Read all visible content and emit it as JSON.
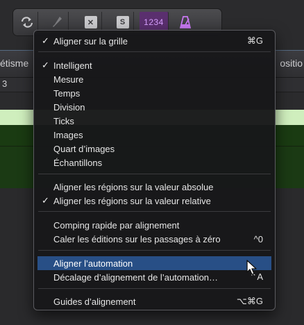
{
  "toolbar": {
    "counter_text": "1234",
    "solo_text": "S",
    "buttons": [
      {
        "name": "cycle-icon"
      },
      {
        "name": "tuner-icon"
      },
      {
        "name": "mute-icon"
      },
      {
        "name": "solo-icon"
      },
      {
        "name": "lcd-counter"
      },
      {
        "name": "metronome-icon"
      }
    ]
  },
  "background": {
    "left_text": "étisme",
    "right_text": "ositio",
    "bar_number": "3"
  },
  "menu": {
    "items": [
      {
        "label": "Aligner sur la grille",
        "shortcut": "⌘G",
        "checked": true
      },
      {
        "label": "Intelligent",
        "shortcut": "",
        "checked": true
      },
      {
        "label": "Mesure",
        "shortcut": "",
        "checked": false
      },
      {
        "label": "Temps",
        "shortcut": "",
        "checked": false
      },
      {
        "label": "Division",
        "shortcut": "",
        "checked": false
      },
      {
        "label": "Ticks",
        "shortcut": "",
        "checked": false
      },
      {
        "label": "Images",
        "shortcut": "",
        "checked": false
      },
      {
        "label": "Quart d’images",
        "shortcut": "",
        "checked": false
      },
      {
        "label": "Échantillons",
        "shortcut": "",
        "checked": false
      },
      {
        "label": "Aligner les régions sur la valeur absolue",
        "shortcut": "",
        "checked": false
      },
      {
        "label": "Aligner les régions sur la valeur relative",
        "shortcut": "",
        "checked": true
      },
      {
        "label": "Comping rapide par alignement",
        "shortcut": "",
        "checked": false
      },
      {
        "label": "Caler les éditions sur les passages à zéro",
        "shortcut": "^0",
        "checked": false
      },
      {
        "label": "Aligner l’automation",
        "shortcut": "",
        "checked": false,
        "highlighted": true
      },
      {
        "label": "Décalage d’alignement de l’automation…",
        "shortcut": "⌃A",
        "checked": false
      },
      {
        "label": "Guides d’alignement",
        "shortcut": "⌥⌘G",
        "checked": false
      }
    ],
    "check_glyph": "✓"
  },
  "colors": {
    "menu_bg": "#18181a",
    "highlight": "#284f86",
    "counter_bg": "#5a2f6e",
    "counter_fg": "#d7a0ff",
    "marker_strip": "#cfeebd",
    "track_green": "#1b3a14"
  }
}
